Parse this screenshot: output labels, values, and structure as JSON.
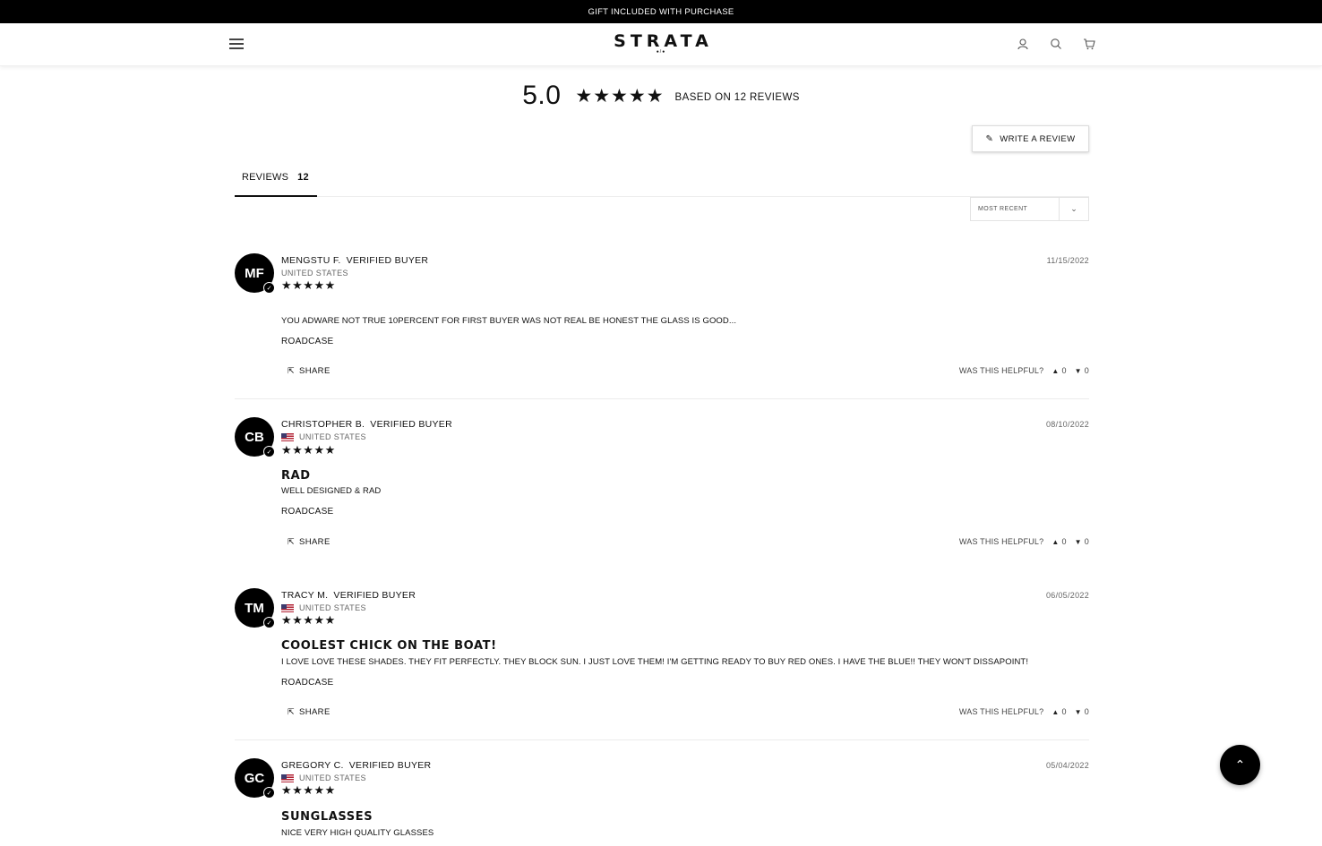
{
  "announcement": "GIFT INCLUDED WITH PURCHASE",
  "header": {
    "logo": "STRATA",
    "logo_sub": "●/●"
  },
  "summary": {
    "average": "5.0",
    "stars": "★★★★★",
    "based_on": "BASED ON 12 REVIEWS"
  },
  "write_review": {
    "icon": "✎",
    "label": "WRITE A REVIEW"
  },
  "tabs": {
    "reviews_label": "REVIEWS",
    "reviews_count": "12"
  },
  "sort": {
    "selected": "MOST RECENT"
  },
  "reviews": [
    {
      "initials": "MF",
      "name": "MENGSTU F.",
      "verified_label": "VERIFIED BUYER",
      "location": "UNITED STATES",
      "show_flag": false,
      "rating": "★★★★★",
      "date": "11/15/2022",
      "title": "",
      "body": "YOU ADWARE NOT TRUE 10PERCENT FOR FIRST BUYER WAS NOT REAL BE HONEST THE GLASS IS GOOD...",
      "product": "ROADCASE",
      "share": "SHARE",
      "helpful": "WAS THIS HELPFUL?",
      "up": "0",
      "down": "0"
    },
    {
      "initials": "CB",
      "name": "CHRISTOPHER B.",
      "verified_label": "VERIFIED BUYER",
      "location": "UNITED STATES",
      "show_flag": true,
      "rating": "★★★★★",
      "date": "08/10/2022",
      "title": "RAD",
      "body": "WELL DESIGNED & RAD",
      "product": "ROADCASE",
      "share": "SHARE",
      "helpful": "WAS THIS HELPFUL?",
      "up": "0",
      "down": "0"
    },
    {
      "initials": "TM",
      "name": "TRACY M.",
      "verified_label": "VERIFIED BUYER",
      "location": "UNITED STATES",
      "show_flag": true,
      "rating": "★★★★★",
      "date": "06/05/2022",
      "title": "COOLEST CHICK ON THE BOAT!",
      "body": "I LOVE LOVE THESE SHADES. THEY FIT PERFECTLY. THEY BLOCK SUN. I JUST LOVE THEM! I'M GETTING READY TO BUY RED ONES. I HAVE THE BLUE!! THEY WON'T DISSAPOINT!",
      "product": "ROADCASE",
      "share": "SHARE",
      "helpful": "WAS THIS HELPFUL?",
      "up": "0",
      "down": "0"
    },
    {
      "initials": "GC",
      "name": "GREGORY C.",
      "verified_label": "VERIFIED BUYER",
      "location": "UNITED STATES",
      "show_flag": true,
      "rating": "★★★★★",
      "date": "05/04/2022",
      "title": "SUNGLASSES",
      "body": "NICE VERY HIGH QUALITY GLASSES"
    }
  ],
  "scroll_top_icon": "⌃"
}
